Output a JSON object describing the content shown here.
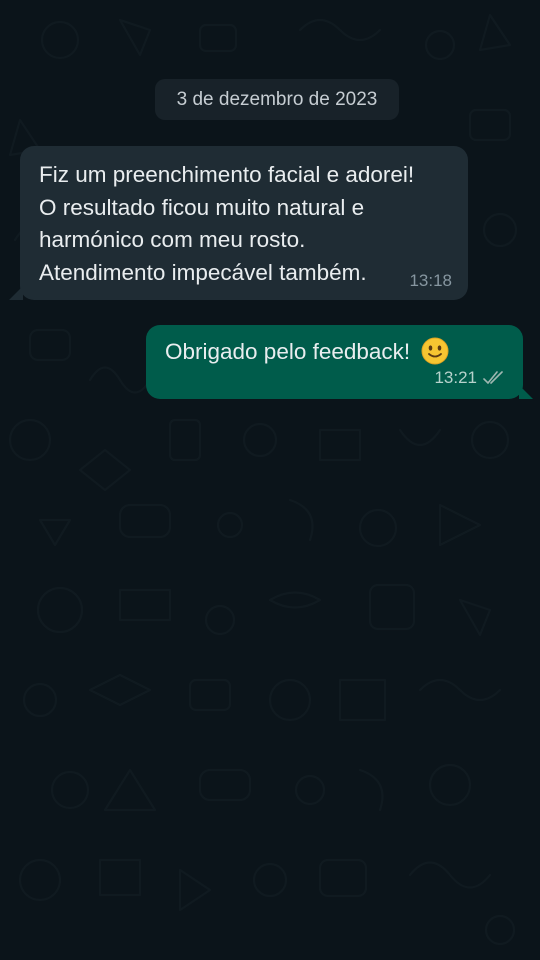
{
  "theme": {
    "background": "#0b141a",
    "incoming_bubble": "#1f2c34",
    "outgoing_bubble": "#005c4b",
    "date_chip": "#182229",
    "text": "#e9edef",
    "meta_text": "#8696a0"
  },
  "date_separator": "3 de dezembro de 2023",
  "messages": [
    {
      "direction": "incoming",
      "lines": [
        "Fiz um preenchimento facial e adorei!",
        "O resultado ficou muito natural e",
        "harmónico com meu rosto.",
        "Atendimento impecável também."
      ],
      "time": "13:18"
    },
    {
      "direction": "outgoing",
      "text": "Obrigado pelo feedback!",
      "emoji": "slightly-smiling-face-icon",
      "time": "13:21",
      "status": "double-check-icon"
    }
  ]
}
